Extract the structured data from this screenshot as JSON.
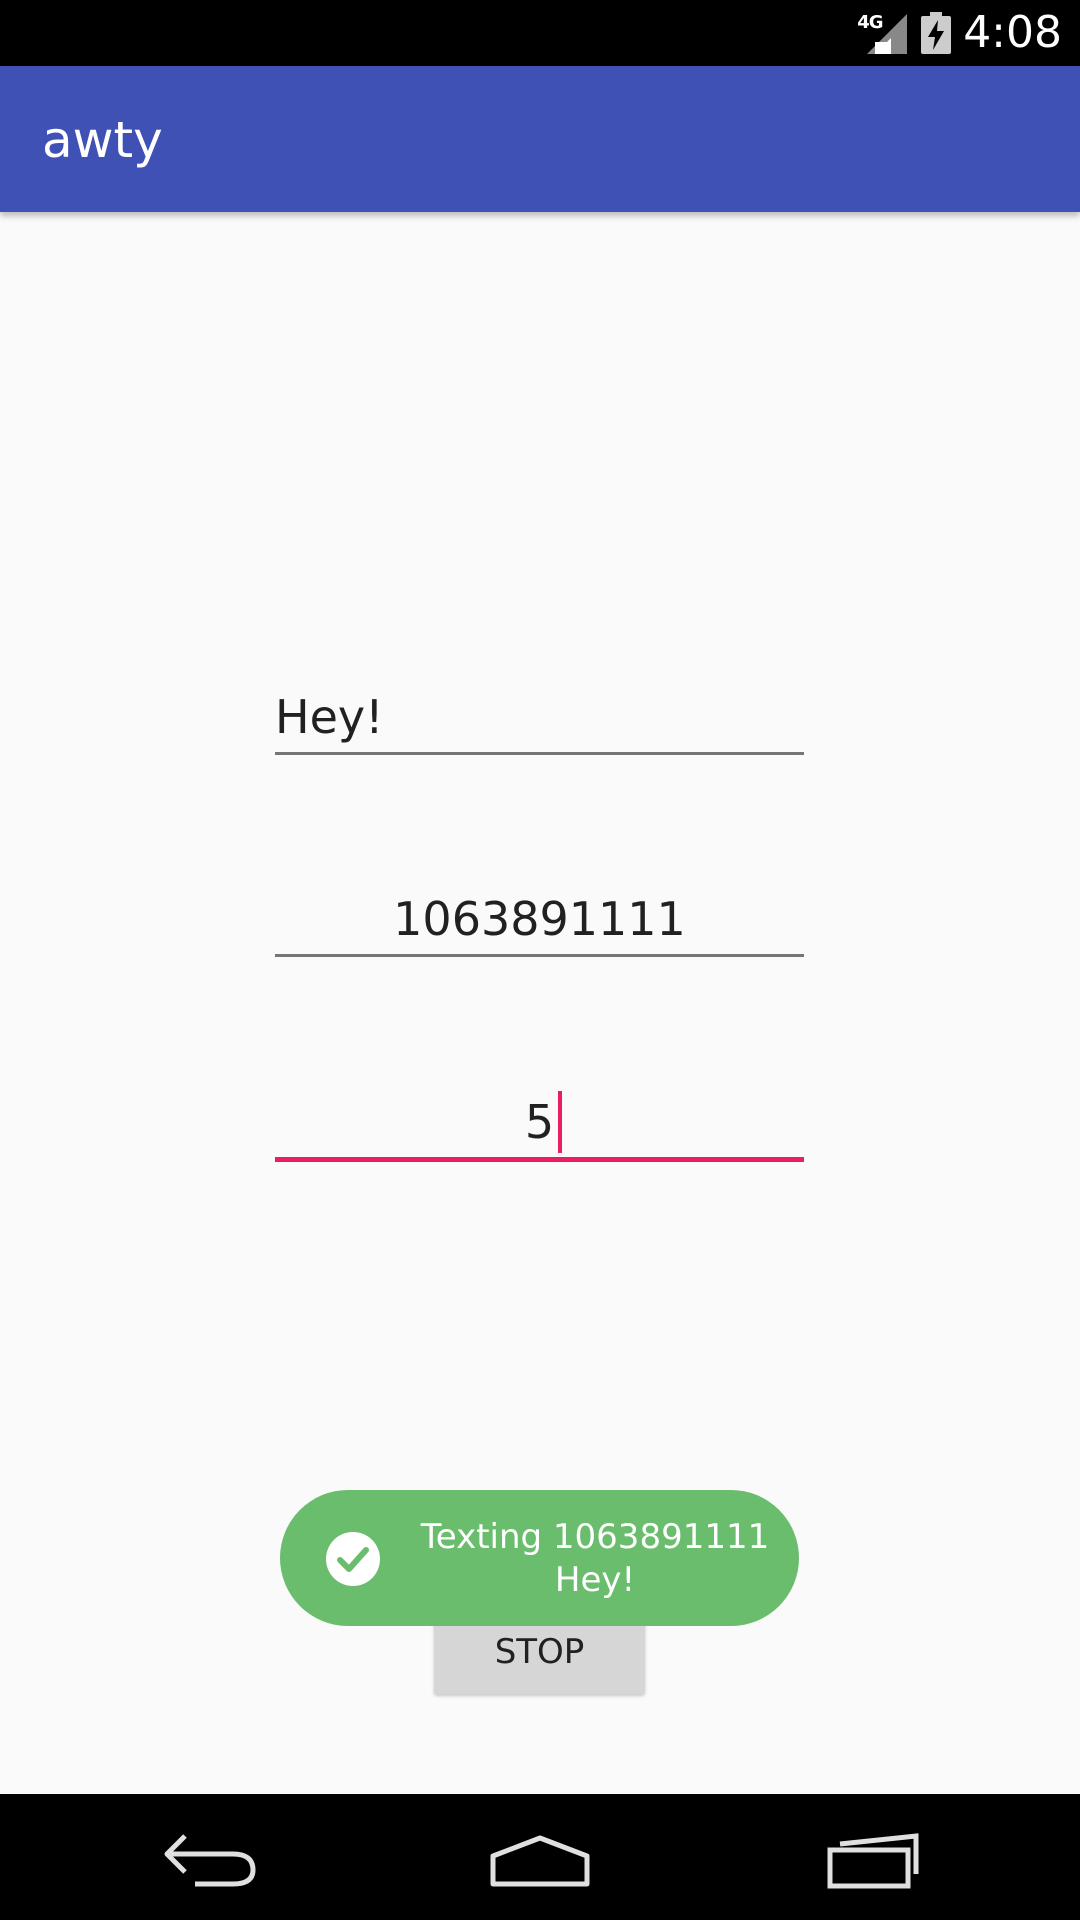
{
  "status_bar": {
    "network_label": "4G",
    "time": "4:08",
    "icons": [
      "signal-icon",
      "battery-charging-icon"
    ]
  },
  "app_bar": {
    "title": "awty"
  },
  "form": {
    "message_value": "Hey!",
    "phone_value": "1063891111",
    "interval_value": "5"
  },
  "stop_button": {
    "label": "STOP"
  },
  "toast": {
    "line1": "Texting 1063891111",
    "line2": "Hey!",
    "icon": "check-circle-icon"
  },
  "nav_bar": {
    "icons": [
      "back-icon",
      "home-icon",
      "recents-icon"
    ]
  },
  "colors": {
    "app_bar": "#3f51b5",
    "accent": "#e91e63",
    "toast": "#69bd6c",
    "button": "#d6d6d6"
  }
}
